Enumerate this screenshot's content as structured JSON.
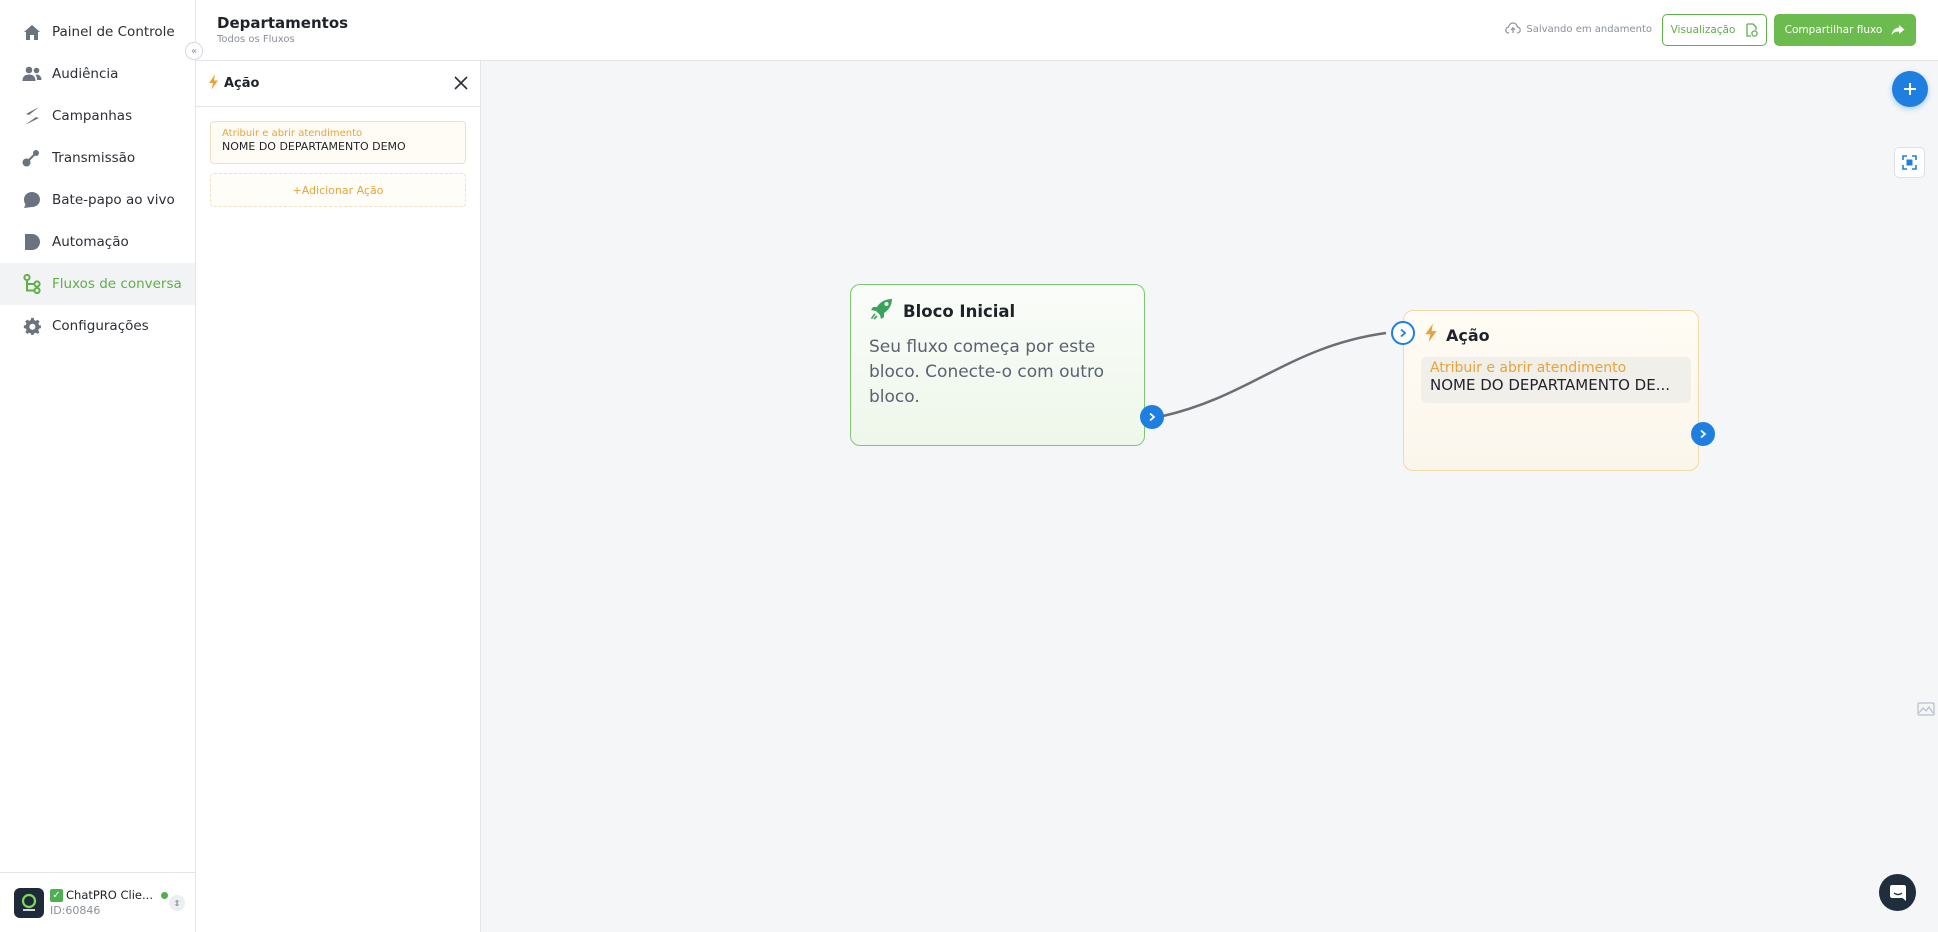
{
  "sidebar": {
    "items": [
      {
        "label": "Painel de Controle",
        "icon": "home-icon"
      },
      {
        "label": "Audiência",
        "icon": "users-icon"
      },
      {
        "label": "Campanhas",
        "icon": "campaign-icon"
      },
      {
        "label": "Transmissão",
        "icon": "broadcast-icon"
      },
      {
        "label": "Bate-papo ao vivo",
        "icon": "chat-bubble-icon"
      },
      {
        "label": "Automação",
        "icon": "automation-icon"
      },
      {
        "label": "Fluxos de conversa",
        "icon": "flow-icon",
        "active": true
      },
      {
        "label": "Configurações",
        "icon": "gear-icon"
      }
    ],
    "account": {
      "name": "ChatPRO Clie...",
      "id": "ID:60846"
    }
  },
  "header": {
    "title": "Departamentos",
    "subtitle": "Todos os Fluxos",
    "saving_status": "Salvando em andamento",
    "preview_label": "Visualização",
    "share_label": "Compartilhar fluxo"
  },
  "panel": {
    "title": "Ação",
    "action": {
      "type": "Atribuir e abrir atendimento",
      "value": "NOME DO DEPARTAMENTO DEMO"
    },
    "add_action_label": "+Adicionar Ação"
  },
  "canvas": {
    "start_node": {
      "title": "Bloco Inicial",
      "text": "Seu fluxo começa por este bloco. Conecte-o com outro bloco."
    },
    "action_node": {
      "title": "Ação",
      "type": "Atribuir e abrir atendimento",
      "value": "NOME DO DEPARTAMENTO DE..."
    }
  },
  "colors": {
    "brand_green": "#5cb046",
    "accent_blue": "#1e7fe0",
    "action_orange": "#e8a33a"
  }
}
